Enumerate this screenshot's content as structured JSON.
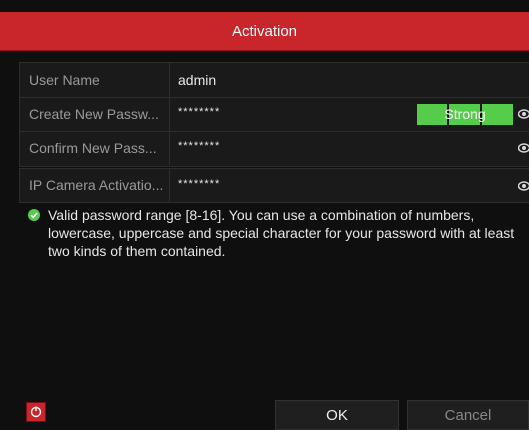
{
  "dialog": {
    "title": "Activation"
  },
  "fields": [
    {
      "label": "User Name",
      "value": "admin"
    },
    {
      "label": "Create New Passw...",
      "value": "********",
      "strength": "Strong"
    },
    {
      "label": "Confirm New Pass...",
      "value": "********"
    },
    {
      "label": "IP Camera Activatio...",
      "value": "********"
    }
  ],
  "hint": {
    "text": "Valid password range [8-16]. You can use a combination of numbers, lowercase, uppercase and special character for your password with at least two kinds of them contained."
  },
  "buttons": {
    "ok": "OK",
    "cancel": "Cancel"
  },
  "colors": {
    "title_bg": "#c9262b",
    "strength_bg": "#56cc4b",
    "panel_bg": "#1a1a1a"
  },
  "icons": {
    "eye": "eye-icon",
    "ok": "checkmark-circle-icon",
    "power": "power-icon"
  }
}
